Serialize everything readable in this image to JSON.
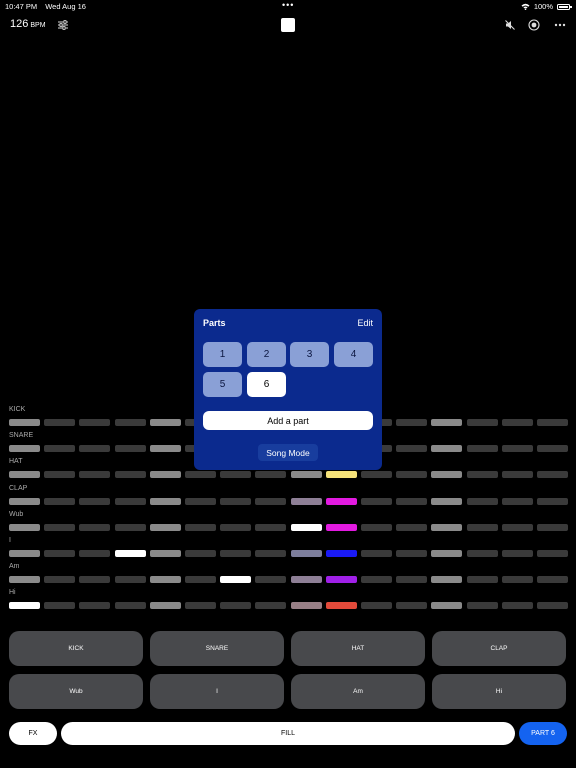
{
  "status": {
    "time": "10:47 PM",
    "date": "Wed Aug 16",
    "dots": "•••",
    "battery": "100%"
  },
  "toolbar": {
    "bpm_value": "126",
    "bpm_unit": "BPM",
    "icons": [
      "sliders-icon",
      "stop-icon",
      "mute-icon",
      "record-icon",
      "more-icon"
    ]
  },
  "tracks": [
    {
      "label": "KICK",
      "steps": [
        "#8a8a8a",
        "#3a3a3a",
        "#3a3a3a",
        "#3a3a3a",
        "#8a8a8a",
        "#3a3a3a",
        "#3a3a3a",
        "#3a3a3a",
        "#8a8a8a",
        "#3a3a3a",
        "#3a3a3a",
        "#3a3a3a",
        "#8a8a8a",
        "#3a3a3a",
        "#3a3a3a",
        "#3a3a3a"
      ]
    },
    {
      "label": "SNARE",
      "steps": [
        "#8a8a8a",
        "#3a3a3a",
        "#3a3a3a",
        "#3a3a3a",
        "#8a8a8a",
        "#3a3a3a",
        "#3a3a3a",
        "#3a3a3a",
        "#8a8a8a",
        "#3a3a3a",
        "#3a3a3a",
        "#3a3a3a",
        "#8a8a8a",
        "#3a3a3a",
        "#3a3a3a",
        "#3a3a3a"
      ]
    },
    {
      "label": "HAT",
      "steps": [
        "#8a8a8a",
        "#3a3a3a",
        "#3a3a3a",
        "#3a3a3a",
        "#8a8a8a",
        "#3a3a3a",
        "#3a3a3a",
        "#3a3a3a",
        "#8a8a8a",
        "#f5e27a",
        "#3a3a3a",
        "#3a3a3a",
        "#8a8a8a",
        "#3a3a3a",
        "#3a3a3a",
        "#3a3a3a"
      ]
    },
    {
      "label": "CLAP",
      "steps": [
        "#8a8a8a",
        "#3a3a3a",
        "#3a3a3a",
        "#3a3a3a",
        "#8a8a8a",
        "#3a3a3a",
        "#3a3a3a",
        "#3a3a3a",
        "#8e7f96",
        "#e21ae0",
        "#3a3a3a",
        "#3a3a3a",
        "#8a8a8a",
        "#3a3a3a",
        "#3a3a3a",
        "#3a3a3a"
      ]
    },
    {
      "label": "Wub",
      "steps": [
        "#8a8a8a",
        "#3a3a3a",
        "#3a3a3a",
        "#3a3a3a",
        "#8a8a8a",
        "#3a3a3a",
        "#3a3a3a",
        "#3a3a3a",
        "#ffffff",
        "#e21ae0",
        "#3a3a3a",
        "#3a3a3a",
        "#8a8a8a",
        "#3a3a3a",
        "#3a3a3a",
        "#3a3a3a"
      ]
    },
    {
      "label": "I",
      "steps": [
        "#8a8a8a",
        "#3a3a3a",
        "#3a3a3a",
        "#ffffff",
        "#8a8a8a",
        "#3a3a3a",
        "#3a3a3a",
        "#3a3a3a",
        "#7d7e9c",
        "#1a1af5",
        "#3a3a3a",
        "#3a3a3a",
        "#8a8a8a",
        "#3a3a3a",
        "#3a3a3a",
        "#3a3a3a"
      ]
    },
    {
      "label": "Am",
      "steps": [
        "#8a8a8a",
        "#3a3a3a",
        "#3a3a3a",
        "#3a3a3a",
        "#8a8a8a",
        "#3a3a3a",
        "#ffffff",
        "#3a3a3a",
        "#8e7f96",
        "#a020e8",
        "#3a3a3a",
        "#3a3a3a",
        "#8a8a8a",
        "#3a3a3a",
        "#3a3a3a",
        "#3a3a3a"
      ]
    },
    {
      "label": "Hi",
      "steps": [
        "#ffffff",
        "#3a3a3a",
        "#3a3a3a",
        "#3a3a3a",
        "#8a8a8a",
        "#3a3a3a",
        "#3a3a3a",
        "#3a3a3a",
        "#987f86",
        "#e24a3a",
        "#3a3a3a",
        "#3a3a3a",
        "#8a8a8a",
        "#3a3a3a",
        "#3a3a3a",
        "#3a3a3a"
      ]
    }
  ],
  "parts_panel": {
    "title": "Parts",
    "edit_label": "Edit",
    "parts": [
      "1",
      "2",
      "3",
      "4",
      "5",
      "6"
    ],
    "selected": "6",
    "add_label": "Add a part",
    "song_mode_label": "Song Mode"
  },
  "pads": [
    "KICK",
    "SNARE",
    "HAT",
    "CLAP",
    "Wub",
    "I",
    "Am",
    "Hi"
  ],
  "bottom": {
    "fx_label": "FX",
    "fill_label": "FILL",
    "part_label": "PART 6"
  },
  "colors": {
    "panel": "#0b2a8e",
    "accent": "#1463f0",
    "pad": "#48494c"
  }
}
